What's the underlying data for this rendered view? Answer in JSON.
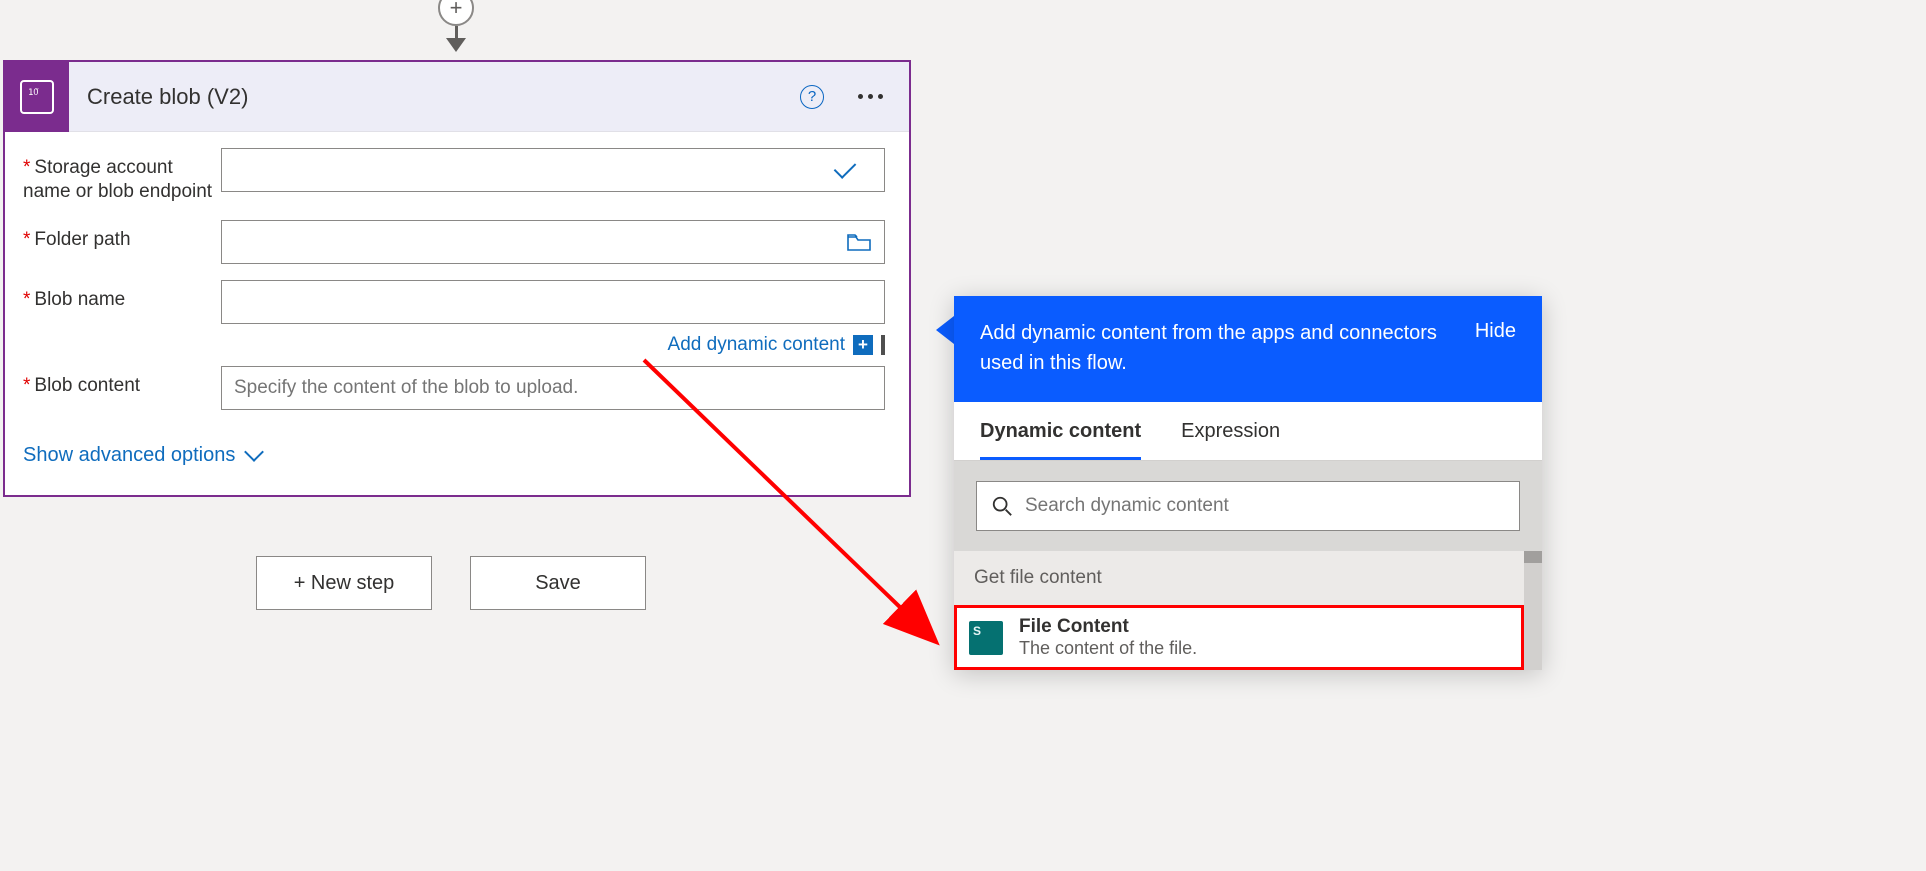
{
  "action": {
    "title": "Create blob (V2)",
    "fields": {
      "storage_label": "Storage account name or blob endpoint",
      "folder_label": "Folder path",
      "blobname_label": "Blob name",
      "blobcontent_label": "Blob content",
      "blobcontent_placeholder": "Specify the content of the blob to upload."
    },
    "add_dynamic_link": "Add dynamic content",
    "show_advanced": "Show advanced options"
  },
  "buttons": {
    "new_step": "+ New step",
    "save": "Save"
  },
  "flyout": {
    "head": "Add dynamic content from the apps and connectors used in this flow.",
    "hide": "Hide",
    "tabs": {
      "dynamic": "Dynamic content",
      "expression": "Expression"
    },
    "search_placeholder": "Search dynamic content",
    "group": "Get file content",
    "item_title": "File Content",
    "item_desc": "The content of the file."
  }
}
